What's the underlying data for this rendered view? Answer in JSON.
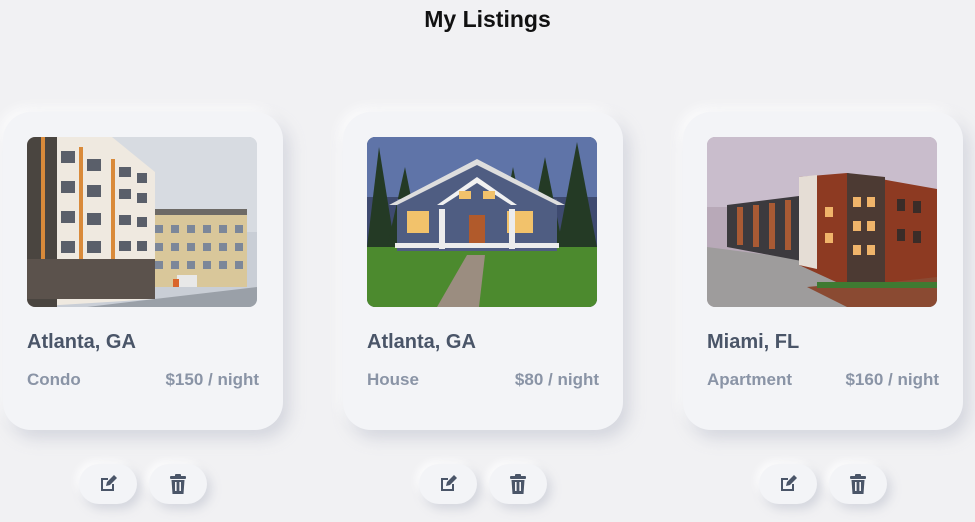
{
  "page": {
    "title": "My Listings"
  },
  "listings": [
    {
      "city": "Atlanta, GA",
      "type": "Condo",
      "price": "$150 / night",
      "photo": "condo-building-photo"
    },
    {
      "city": "Atlanta, GA",
      "type": "House",
      "price": "$80 / night",
      "photo": "craftsman-house-photo"
    },
    {
      "city": "Miami, FL",
      "type": "Apartment",
      "price": "$160 / night",
      "photo": "apartment-complex-photo"
    }
  ],
  "icons": {
    "edit": "edit-icon",
    "delete": "trash-icon"
  },
  "colors": {
    "background": "#f1f1f3",
    "card": "#f3f4f7",
    "city_text": "#4a5568",
    "meta_text": "#8a94a6",
    "icon": "#4a5568"
  }
}
